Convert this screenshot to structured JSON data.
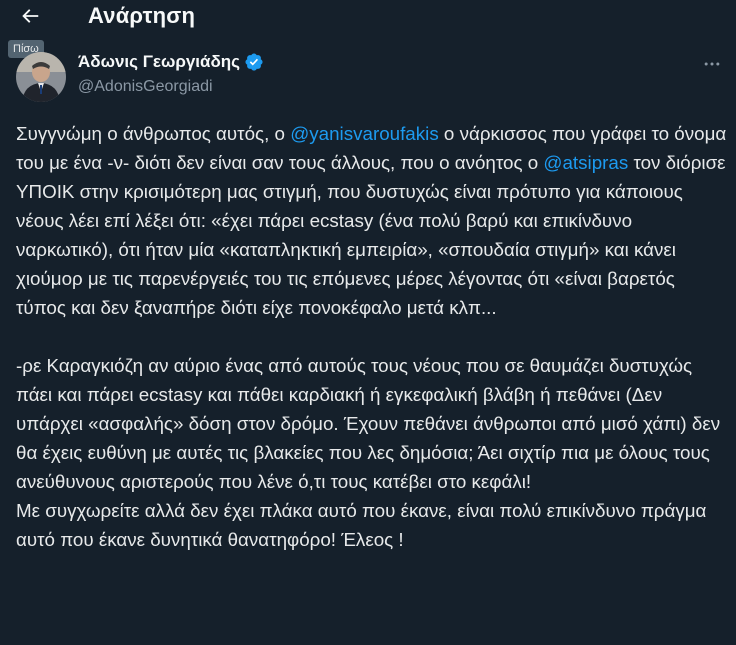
{
  "header": {
    "title": "Ανάρτηση",
    "back_tooltip": "Πίσω"
  },
  "author": {
    "name": "Άδωνις Γεωργιάδης",
    "handle": "@AdonisGeorgiadi",
    "verified": true
  },
  "tweet": {
    "p1": {
      "t1": "Συγγνώμη ο άνθρωπος αυτός, ο ",
      "m1": "@yanisvaroufakis",
      "t2": " ο νάρκισσος που γράφει το όνομα του με ένα -ν- διότι δεν είναι σαν τους άλλους, που ο ανόητος ο ",
      "m2": "@atsipras",
      "t3": " τον διόρισε ΥΠΟΙΚ στην κρισιμότερη μας στιγμή, που δυστυχώς είναι πρότυπο για κάποιους νέους λέει επί λέξει ότι: «έχει πάρει  ecstasy (ένα πολύ βαρύ και επικίνδυνο ναρκωτικό), ότι ήταν μία «καταπληκτική εμπειρία», «σπουδαία στιγμή» και κάνει χιούμορ με τις παρενέργειές του τις επόμενες μέρες λέγοντας ότι «είναι βαρετός τύπος και δεν ξαναπήρε διότι είχε πονοκέφαλο μετά κλπ..."
    },
    "p2": "-ρε Καραγκιόζη αν αύριο ένας από αυτούς τους νέους που σε θαυμάζει δυστυχώς πάει και πάρει ecstasy και πάθει καρδιακή ή εγκεφαλική βλάβη ή πεθάνει (Δεν υπάρχει «ασφαλής» δόση στον δρόμο. Έχουν πεθάνει άνθρωποι από μισό χάπι) δεν θα έχεις ευθύνη με αυτές τις βλακείες που λες δημόσια; Άει σιχτίρ πια με όλους τους ανεύθυνους αριστερούς που λένε ό,τι τους κατέβει στο κεφάλι!",
    "p3": "Με συγχωρείτε αλλά δεν έχει πλάκα αυτό που έκανε, είναι πολύ επικίνδυνο πράγμα αυτό που έκανε δυνητικά θανατηφόρο! Έλεος !"
  },
  "icons": {
    "back": "arrow-left-icon",
    "verified": "verified-badge-icon",
    "more": "more-horizontal-icon"
  },
  "colors": {
    "background": "#15202b",
    "text": "#e7e9ea",
    "secondary": "#8b98a5",
    "accent": "#1d9bf0"
  }
}
